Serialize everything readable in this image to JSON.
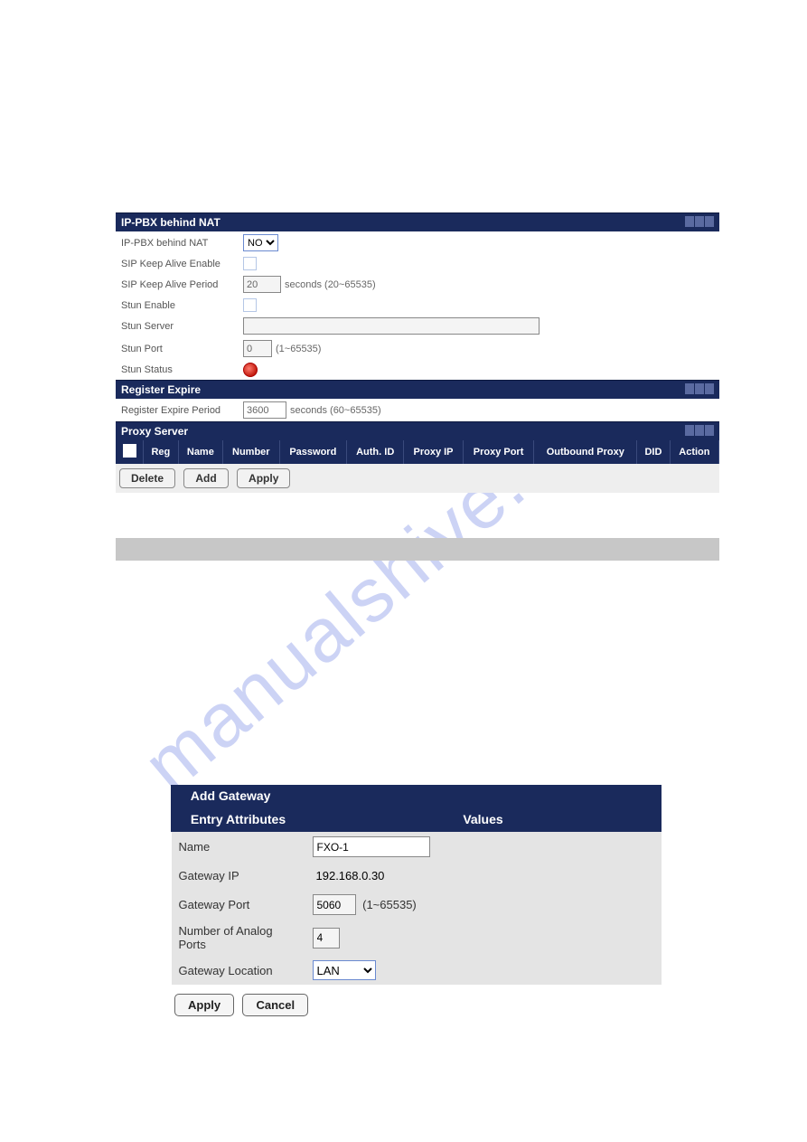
{
  "watermark": "manualshive.com",
  "nat": {
    "section": "IP-PBX behind NAT",
    "behind_label": "IP-PBX behind NAT",
    "behind_value": "NO",
    "keepalive_enable_label": "SIP Keep Alive Enable",
    "keepalive_period_label": "SIP Keep Alive Period",
    "keepalive_period_value": "20",
    "keepalive_period_hint": "seconds (20~65535)",
    "stun_enable_label": "Stun Enable",
    "stun_server_label": "Stun Server",
    "stun_server_value": "",
    "stun_port_label": "Stun Port",
    "stun_port_value": "0",
    "stun_port_hint": "(1~65535)",
    "stun_status_label": "Stun Status"
  },
  "register": {
    "section": "Register Expire",
    "period_label": "Register Expire Period",
    "period_value": "3600",
    "period_hint": "seconds (60~65535)"
  },
  "proxy": {
    "section": "Proxy Server",
    "cols": [
      "",
      "Reg",
      "Name",
      "Number",
      "Password",
      "Auth. ID",
      "Proxy IP",
      "Proxy Port",
      "Outbound Proxy",
      "DID",
      "Action"
    ]
  },
  "buttons": {
    "delete": "Delete",
    "add": "Add",
    "apply": "Apply",
    "cancel": "Cancel"
  },
  "gateway": {
    "title": "Add Gateway",
    "col_attributes": "Entry Attributes",
    "col_values": "Values",
    "name_label": "Name",
    "name_value": "FXO-1",
    "ip_label": "Gateway IP",
    "ip_value": "192.168.0.30",
    "port_label": "Gateway Port",
    "port_value": "5060",
    "port_hint": "(1~65535)",
    "analog_label": "Number of Analog Ports",
    "analog_value": "4",
    "location_label": "Gateway Location",
    "location_value": "LAN"
  }
}
